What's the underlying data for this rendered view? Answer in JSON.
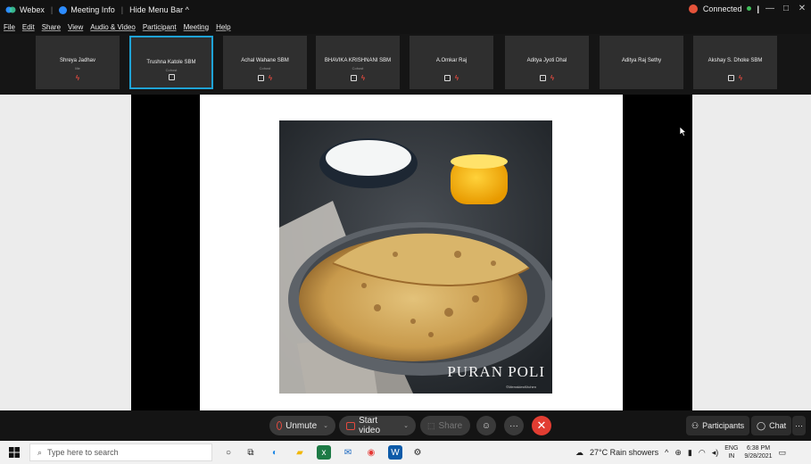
{
  "titlebar": {
    "app_name": "Webex",
    "meeting_info": "Meeting Info",
    "hide_menu": "Hide Menu Bar ^",
    "status": "Connected",
    "btn_min": "—",
    "btn_max": "□",
    "btn_close": "✕"
  },
  "menu": [
    "File",
    "Edit",
    "Share",
    "View",
    "Audio & Video",
    "Participant",
    "Meeting",
    "Help"
  ],
  "participants": [
    {
      "name": "Shreya Jadhav",
      "sub": "Me"
    },
    {
      "name": "Trushna Katole SBM",
      "sub": "Cohost"
    },
    {
      "name": "Achal Wahane SBM",
      "sub": "Cohost"
    },
    {
      "name": "BHAVIKA KRISHNANI SBM",
      "sub": "Cohost"
    },
    {
      "name": "A.Omkar Raj",
      "sub": ""
    },
    {
      "name": "Aditya Jyoti Dhal",
      "sub": ""
    },
    {
      "name": "Aditya Raj Sethy",
      "sub": ""
    },
    {
      "name": "Akshay S. Dhoke SBM",
      "sub": ""
    }
  ],
  "slide": {
    "caption": "PURAN POLI",
    "credit": "©MerrakiesKitchen"
  },
  "controls": {
    "unmute": "Unmute",
    "start_video": "Start video",
    "share": "Share",
    "participants": "Participants",
    "chat": "Chat",
    "more": "···"
  },
  "taskbar": {
    "search_placeholder": "Type here to search",
    "weather": "27°C  Rain showers",
    "lang_top": "ENG",
    "lang_bottom": "IN",
    "time": "6:38 PM",
    "date": "9/28/2021"
  },
  "colors": {
    "accent": "#1fa3d6",
    "end_call": "#e23d32",
    "mute_red": "#e24a3f"
  }
}
